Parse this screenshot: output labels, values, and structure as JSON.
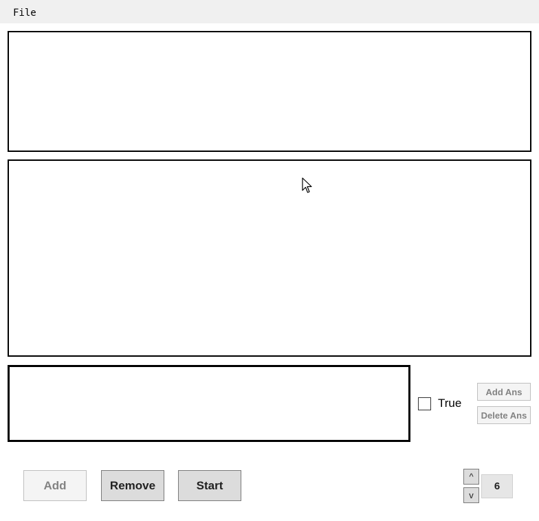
{
  "menu": {
    "file_label": "File"
  },
  "answer_panel": {
    "true_label": "True",
    "true_checked": false,
    "add_answer_label": "Add Ans",
    "delete_answer_label": "Delete Ans"
  },
  "actions": {
    "add_label": "Add",
    "remove_label": "Remove",
    "start_label": "Start"
  },
  "spinner": {
    "up_label": "^",
    "down_label": "v",
    "value": "6"
  },
  "icons": {
    "pointer": "mouse-pointer-icon"
  }
}
